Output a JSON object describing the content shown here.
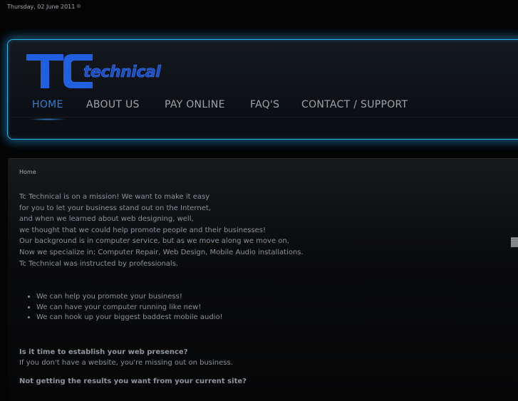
{
  "topbar": {
    "date": "Thursday, 02 June 2011"
  },
  "logo": {
    "big_text": "TC",
    "small_text": "technical",
    "icon": "logo-icon"
  },
  "nav": {
    "items": [
      {
        "label": "HOME",
        "active": true
      },
      {
        "label": "ABOUT US",
        "active": false
      },
      {
        "label": "PAY ONLINE",
        "active": false
      },
      {
        "label": "FAQ'S",
        "active": false
      },
      {
        "label": "CONTACT / SUPPORT",
        "active": false
      }
    ]
  },
  "breadcrumb": "Home",
  "intro_lines": [
    "Tc Technical is on a mission! We want to make it easy",
    "for you to let your business stand out on the Internet,",
    "and when we learned about web designing, well,",
    "we thought that we could help promote people and their businesses!",
    "Our background is in computer service, but as we move along we move on,",
    "Now we specialize in; Computer Repair, Web Design, Mobile Audio installations.",
    "Tc Technical was instructed by professionals."
  ],
  "bullets": [
    "We can help you promote your business!",
    "We can have your computer running like new!",
    "We can hook up your biggest baddest mobile audio!"
  ],
  "questions": [
    {
      "q": "Is it time to establish your web presence?",
      "a": "If you don't have a website, you're missing out on business."
    },
    {
      "q": "Not getting the results you want from your current site?",
      "a": ""
    }
  ],
  "colors": {
    "accent": "#2f7fd8",
    "glow": "#2bb6e8",
    "logo_blue": "#1f5fe0"
  }
}
